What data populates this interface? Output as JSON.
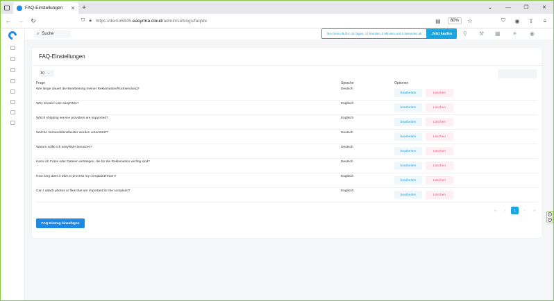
{
  "browser": {
    "tab_title": "FAQ-Einstellungen",
    "new_tab": "+",
    "url_prefix": "https://demo5845.",
    "url_domain": "easyrma.cloud",
    "url_path": "/admin/settings/faq/de",
    "zoom": "80%"
  },
  "header": {
    "search_placeholder": "Suche",
    "demo_notice": "Ihre Demo läuft in 16 Tagen, 17 Stunden, 5 Minuten und 6 Sekunden ab",
    "buy_now": "Jetzt kaufen"
  },
  "page": {
    "title": "FAQ-Einstellungen",
    "page_size": "10",
    "columns": {
      "question": "Frage",
      "language": "Sprache",
      "options": "Optionen"
    },
    "edit_label": "bearbeiten",
    "delete_label": "Löschen",
    "rows": [
      {
        "question": "Wie lange dauert die Bearbeitung meiner Reklamation/Rücksendung?",
        "language": "Deutsch"
      },
      {
        "question": "Why should I use easyRMA?",
        "language": "Englisch"
      },
      {
        "question": "Which shipping service providers are supported?",
        "language": "Englisch"
      },
      {
        "question": "Welche Versanddienstleister werden unterstützt?",
        "language": "Deutsch"
      },
      {
        "question": "Warum sollte ich easyRMA benutzen?",
        "language": "Deutsch"
      },
      {
        "question": "Kann ich Fotos oder Dateien anhängen, die für die Reklamation wichtig sind?",
        "language": "Deutsch"
      },
      {
        "question": "How long does it take to process my complaint/return?",
        "language": "Englisch"
      },
      {
        "question": "Can I attach photos or files that are important for the complaint?",
        "language": "Englisch"
      }
    ],
    "pagination": {
      "first": "«",
      "prev": "‹",
      "current": "1",
      "next": "›",
      "last": "»"
    },
    "add_button": "FAQ-Eintrag hinzufügen"
  },
  "colors": {
    "accent": "#1ea4de",
    "primary_button": "#1e88e5",
    "delete": "#e05a7a",
    "frame": "#8bc34a"
  }
}
